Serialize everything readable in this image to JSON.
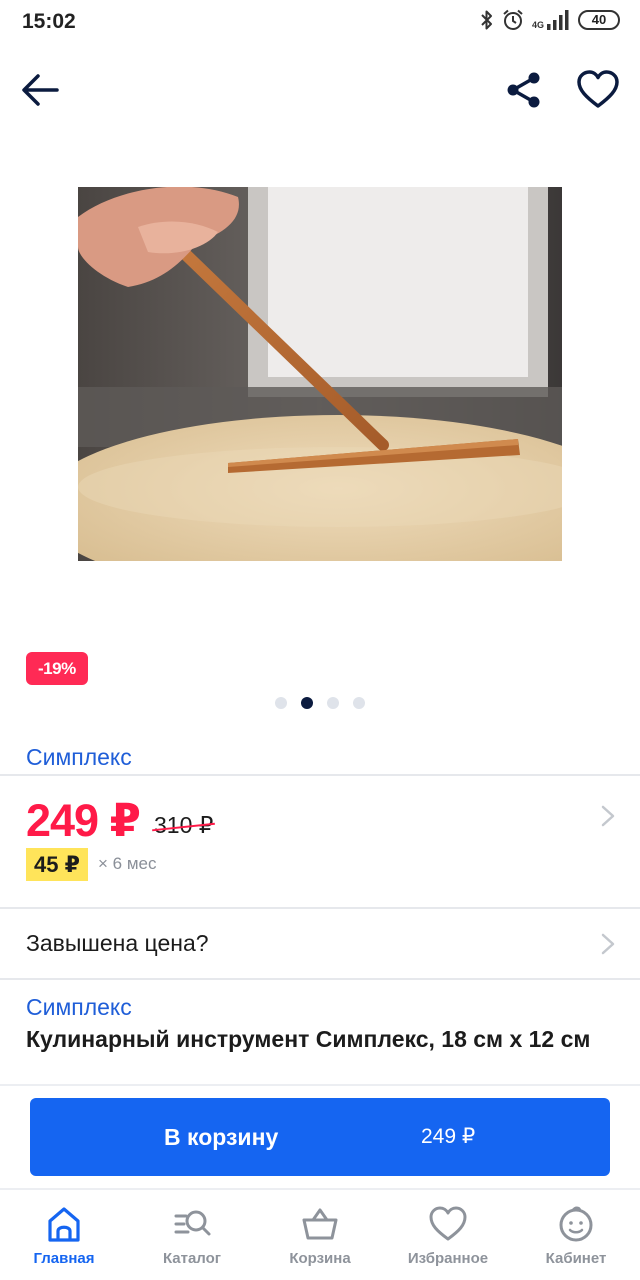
{
  "status_bar": {
    "time": "15:02",
    "network": "4G",
    "battery": "40",
    "icons": [
      "bluetooth-icon",
      "alarm-icon",
      "signal-icon",
      "battery-icon"
    ]
  },
  "product": {
    "discount_badge": "-19%",
    "gallery": {
      "total_slides": 4,
      "active_slide": 2
    },
    "brand": "Симплекс",
    "price": "249 ₽",
    "old_price": "310 ₽",
    "installment_amount": "45 ₽",
    "installment_term": "× 6 мес",
    "price_question": "Завышена цена?",
    "brand_secondary": "Симплекс",
    "title": "Кулинарный инструмент Симплекс, 18 см x 12 см"
  },
  "cart_button": {
    "label": "В корзину",
    "price": "249 ₽"
  },
  "bottom_nav": {
    "items": [
      {
        "label": "Главная",
        "icon": "home-icon",
        "active": true
      },
      {
        "label": "Каталог",
        "icon": "catalog-search-icon",
        "active": false
      },
      {
        "label": "Корзина",
        "icon": "basket-icon",
        "active": false
      },
      {
        "label": "Избранное",
        "icon": "heart-icon",
        "active": false
      },
      {
        "label": "Кабинет",
        "icon": "profile-face-icon",
        "active": false
      }
    ]
  },
  "colors": {
    "accent": "#1565f1",
    "brand_link": "#1f5ed8",
    "price_red": "#ff1a48",
    "badge_red": "#ff2a55",
    "installment_yellow": "#ffe45a",
    "nav_inactive": "#8e939b"
  }
}
